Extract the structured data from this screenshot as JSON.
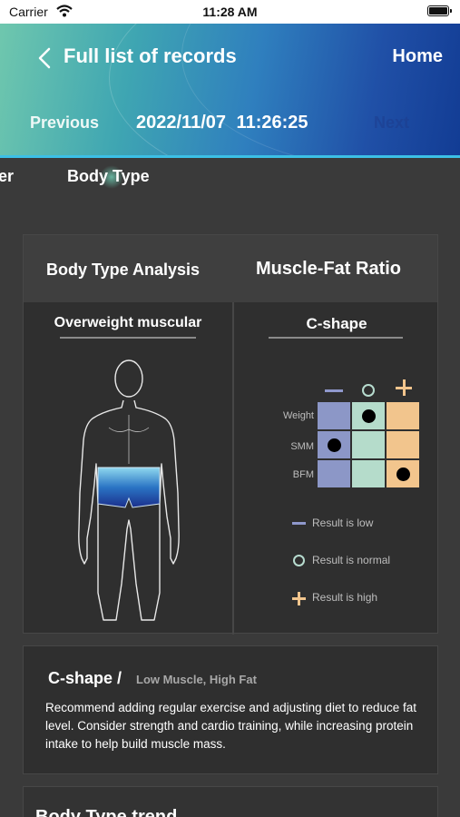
{
  "status_bar": {
    "carrier": "Carrier",
    "time": "11:28 AM"
  },
  "header": {
    "title": "Full list of records",
    "home_label": "Home",
    "prev_label": "Previous",
    "next_label": "Next",
    "record_datetime": "2022/11/07 11:26:25"
  },
  "tabs": {
    "previous_partial": "er",
    "active": "Body Type"
  },
  "analysis": {
    "left_heading": "Body Type Analysis",
    "right_heading": "Muscle-Fat Ratio",
    "body_type": "Overweight muscular",
    "shape": "C-shape",
    "grid": {
      "rows": [
        "Weight",
        "SMM",
        "BFM"
      ],
      "columns": [
        "low",
        "normal",
        "high"
      ],
      "results": {
        "Weight": "normal",
        "SMM": "low",
        "BFM": "high"
      }
    },
    "legend": {
      "low": "Result is low",
      "normal": "Result is normal",
      "high": "Result is high"
    },
    "colors": {
      "low": "#8c97c7",
      "normal": "#b5dccb",
      "high": "#f2c58d"
    }
  },
  "recommendation": {
    "title": "C-shape /",
    "subtitle": "Low Muscle, High Fat",
    "body": "Recommend adding regular exercise and adjusting diet to reduce fat level. Consider strength and cardio training, while increasing protein intake to help build muscle mass."
  },
  "trend": {
    "title": "Body Type trend"
  }
}
